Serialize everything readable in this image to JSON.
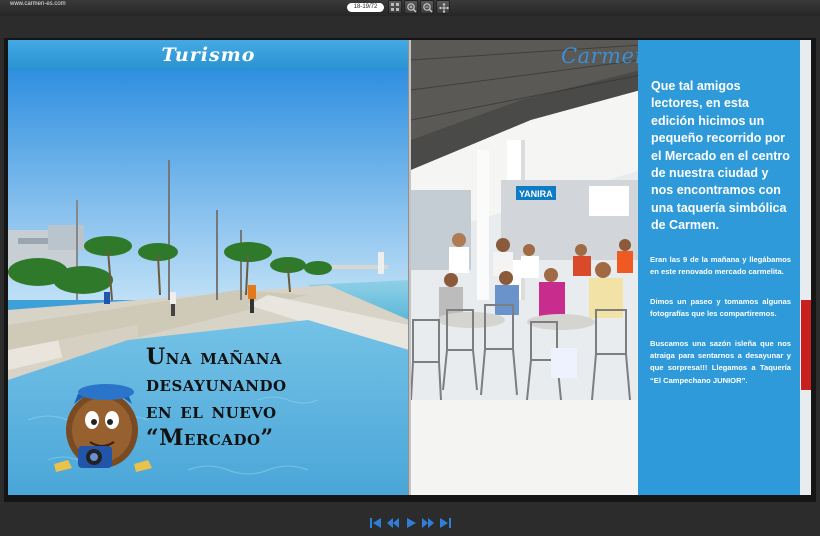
{
  "viewer": {
    "site_url": "www.carmen-es.com",
    "page_counter": "18-19/72",
    "tools": [
      "grid-icon",
      "zoom-in-icon",
      "zoom-out-icon",
      "move-icon"
    ]
  },
  "left_page": {
    "section": "Turismo",
    "headline_lines": [
      "Una mañana",
      "desayunando",
      "en el nuevo",
      "“Mercado”"
    ]
  },
  "right_page": {
    "brand": "Carmen.es",
    "intro": "Que tal amigos lectores, en esta edición hicimos un pequeño recorrido por el Mercado en el centro de nuestra ciudad y nos encontramos con una taquería simbólica de Carmen.",
    "paragraphs": [
      "Eran las 9 de la mañana y llegábamos en este renovado mercado carmelita.",
      "Dimos un paseo y tomamos algunas fotografías que les compartiremos.",
      "Buscamos una sazón isleña que nos atraiga para sentarnos a desayunar y que sorpresa!!! Llegamos a Taquería “El Campechano JUNIOR”."
    ],
    "sign_text": "YANIRA"
  },
  "navigation": [
    "first-page-icon",
    "previous-page-icon",
    "play-icon",
    "next-page-icon",
    "last-page-icon"
  ],
  "colors": {
    "accent": "#2e9ad9",
    "nav": "#2f7fd9"
  }
}
